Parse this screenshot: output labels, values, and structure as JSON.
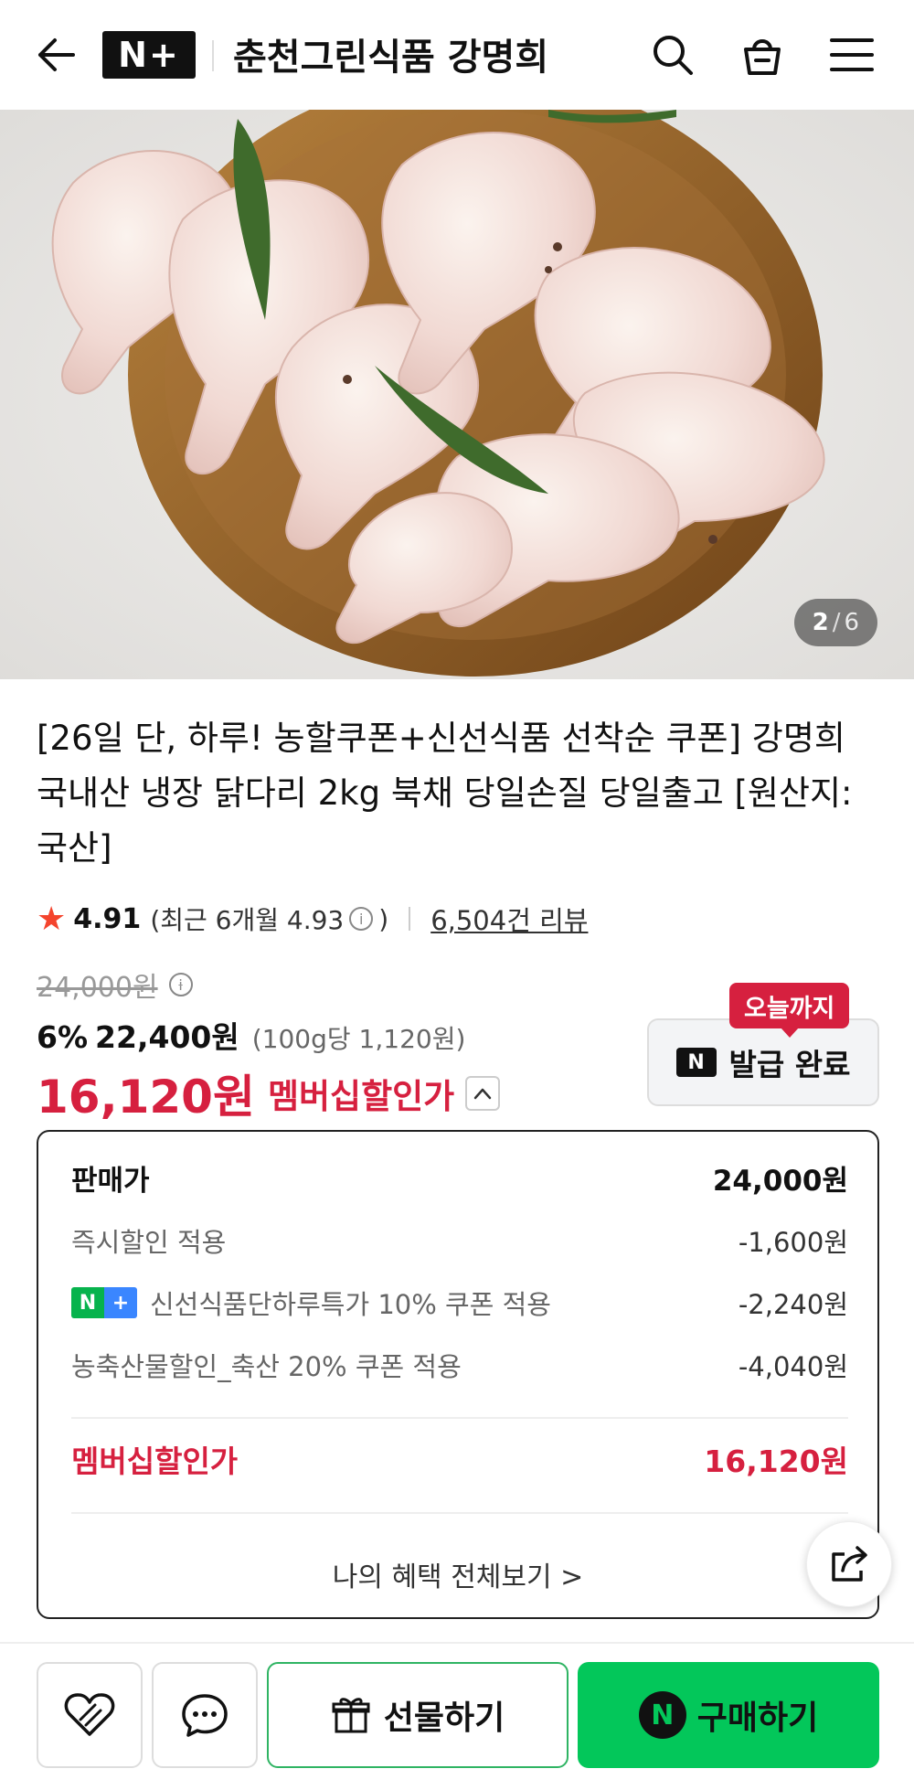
{
  "header": {
    "logo_text": "N+",
    "store_name": "춘천그린식품 강명희"
  },
  "hero": {
    "image_alt": "raw chicken drumsticks on wooden board",
    "page_current": "2",
    "page_separator": "/",
    "page_total": "6"
  },
  "product": {
    "title": "[26일 단, 하루! 농할쿠폰+신선식품 선착순 쿠폰] 강명희 국내산 냉장 닭다리 2kg 북채 당일손질 당일출고 [원산지: 국산]"
  },
  "rating": {
    "score": "4.91",
    "recent_prefix": "(최근 6개월 4.93",
    "recent_suffix": ")",
    "reviews": "6,504건 리뷰"
  },
  "price": {
    "original": "24,000원",
    "discount_percent": "6%",
    "discount_price": "22,400원",
    "unit_price": "(100g당 1,120원)",
    "member_price": "16,120원",
    "member_label": "멤버십할인가"
  },
  "coupon": {
    "badge": "오늘까지",
    "n_logo": "N",
    "label": "발급 완료"
  },
  "breakdown": {
    "sale_label": "판매가",
    "sale_value": "24,000원",
    "instant_label": "즉시할인 적용",
    "instant_value": "-1,600원",
    "nplus_coupon_label": "신선식품단하루특가 10% 쿠폰 적용",
    "nplus_coupon_value": "-2,240원",
    "farm_coupon_label": "농축산물할인_축산 20% 쿠폰 적용",
    "farm_coupon_value": "-4,040원",
    "member_label": "멤버십할인가",
    "member_value": "16,120원",
    "benefit_link": "나의 혜택 전체보기 >"
  },
  "bottom_bar": {
    "gift_label": "선물하기",
    "buy_logo": "N",
    "buy_label": "구매하기"
  },
  "colors": {
    "accent_red": "#d6203f",
    "naver_green": "#03c75a",
    "star": "#f4442d"
  }
}
